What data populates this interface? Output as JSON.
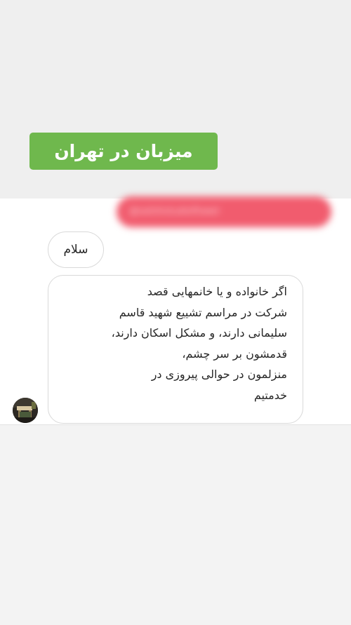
{
  "header": {
    "title": "میزبان در تهران"
  },
  "reply": {
    "text": "@sailshstudioflowel"
  },
  "messages": {
    "greeting": "سلام",
    "body_lines": [
      "اگر خانواده و یا خانمهایی قصد",
      "شرکت در مراسم تشییع شهید قاسم",
      "سلیمانی دارند، و مشکل اسکان دارند،",
      "قدمشون بر سر چشم،",
      "منزلمون در حوالی پیروزی در",
      "خدمتیم"
    ]
  },
  "colors": {
    "title_badge": "#6fb84d",
    "reply_bubble": "#f15c6e",
    "bubble_border": "#d9d9d9"
  },
  "icons": {
    "avatar": "profile-photo"
  }
}
